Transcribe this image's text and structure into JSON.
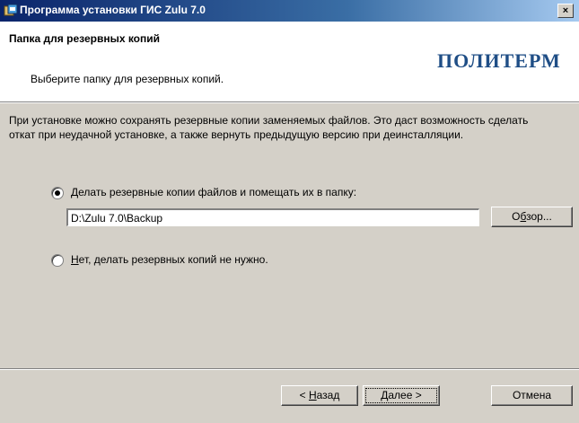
{
  "window": {
    "title": "Программа установки ГИС Zulu 7.0",
    "close_label": "×"
  },
  "header": {
    "title": "Папка для резервных копий",
    "subtitle": "Выберите папку для резервных копий.",
    "logo_text": "ПОЛИТЕРМ"
  },
  "body": {
    "description": "При установке можно сохранять резервные копии заменяемых файлов. Это даст возможность сделать откат при неудачной установке, а также вернуть предыдущую версию при деинсталляции.",
    "option_backup": {
      "hotkey": "Д",
      "label_rest": "елать резервные копии файлов и помещать их в папку:",
      "selected": true
    },
    "path_value": "D:\\Zulu 7.0\\Backup",
    "browse_button": {
      "pre": "О",
      "hotkey": "б",
      "post": "зор..."
    },
    "option_nobackup": {
      "hotkey": "Н",
      "label_rest": "ет, делать резервных копий не нужно.",
      "selected": false
    }
  },
  "footer": {
    "back_button": {
      "pre": "< ",
      "hotkey": "Н",
      "post": "азад"
    },
    "next_button": {
      "hotkey": "Д",
      "post": "алее >"
    },
    "cancel_label": "Отмена"
  },
  "colors": {
    "title_bar": "#0a246a",
    "logo": "#1f4e86",
    "dialog_bg": "#d4d0c8"
  }
}
